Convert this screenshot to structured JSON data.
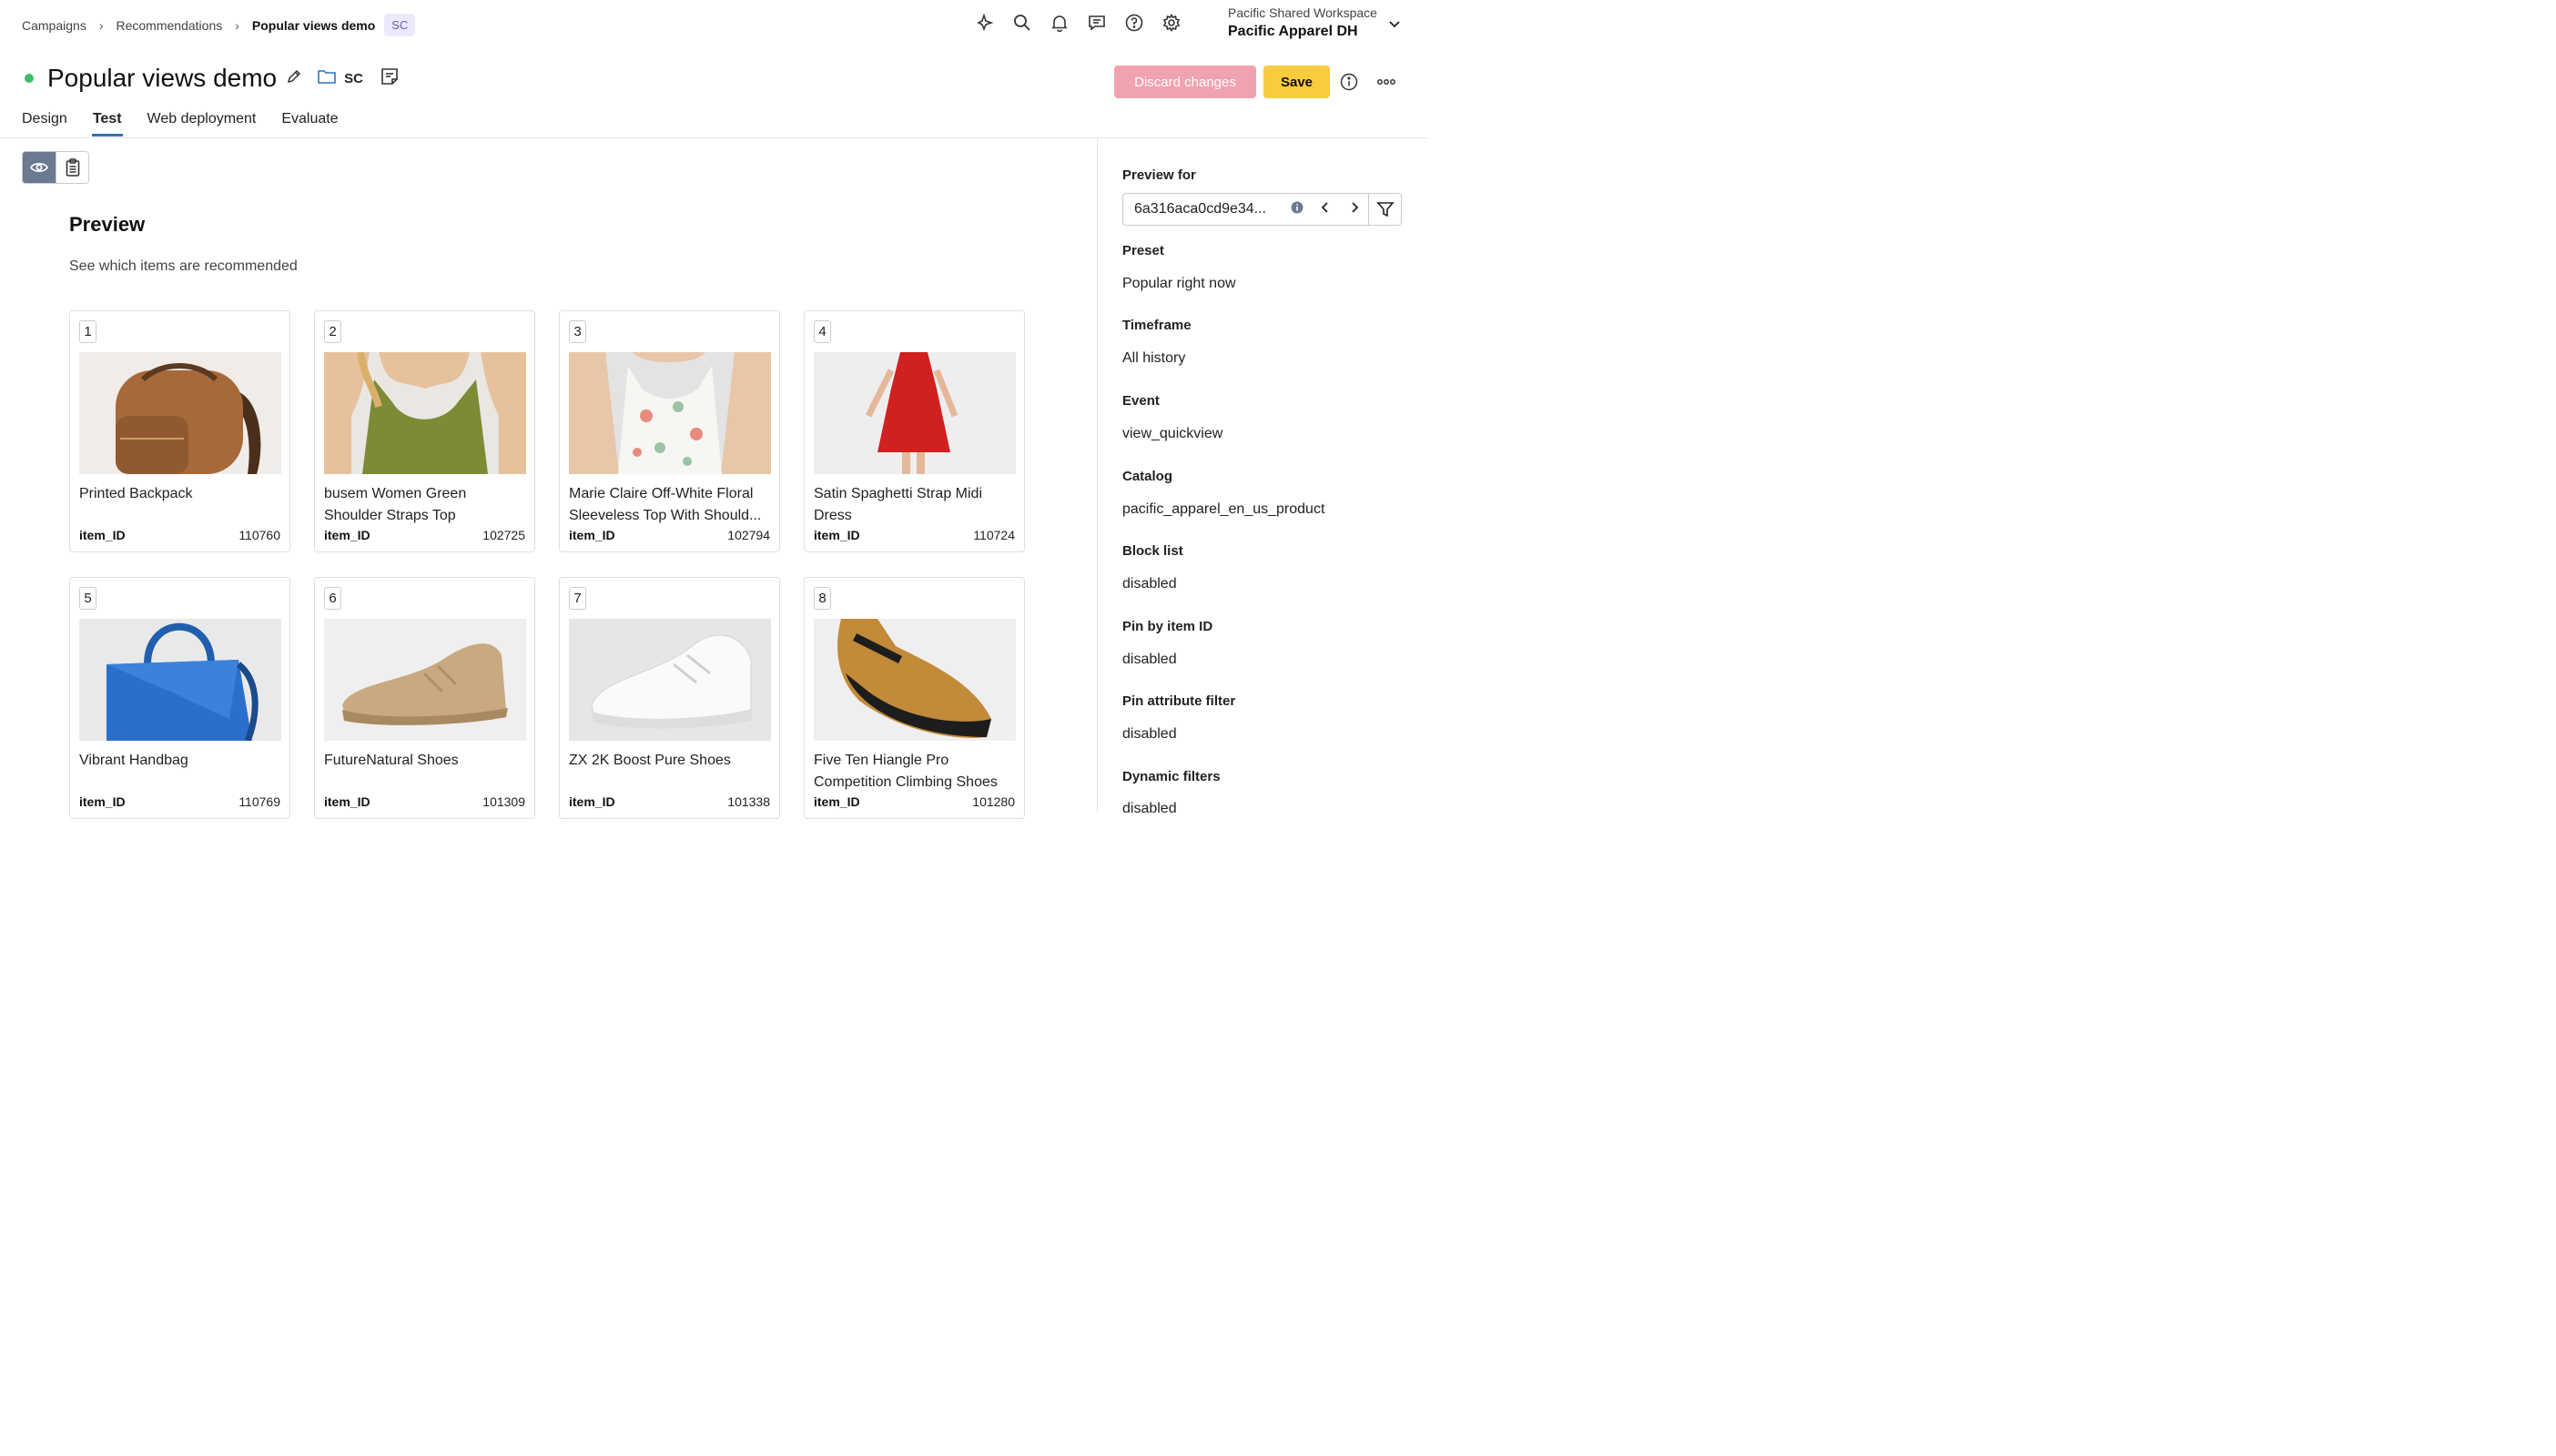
{
  "breadcrumb": {
    "items": [
      "Campaigns",
      "Recommendations"
    ],
    "current": "Popular views demo",
    "badge": "SC"
  },
  "header": {
    "icons": [
      "sparkle-icon",
      "search-icon",
      "bell-icon",
      "chat-icon",
      "help-icon",
      "gear-icon"
    ],
    "workspace_name": "Pacific Shared Workspace",
    "org_name": "Pacific Apparel DH"
  },
  "title": {
    "text": "Popular views demo",
    "folder_label": "SC",
    "status_color": "#3ebd6a"
  },
  "actions": {
    "discard_label": "Discard changes",
    "save_label": "Save"
  },
  "tabs": [
    {
      "label": "Design"
    },
    {
      "label": "Test",
      "active": true
    },
    {
      "label": "Web deployment"
    },
    {
      "label": "Evaluate"
    }
  ],
  "preview": {
    "title": "Preview",
    "subtitle": "See which items are recommended",
    "id_label": "item_ID",
    "items": [
      {
        "rank": "1",
        "name": "Printed Backpack",
        "id": "110760",
        "image": "backpack"
      },
      {
        "rank": "2",
        "name": "busem Women Green Shoulder Straps Top",
        "id": "102725",
        "image": "green-top"
      },
      {
        "rank": "3",
        "name": "Marie Claire Off-White Floral Sleeveless Top With Should...",
        "id": "102794",
        "image": "floral-top"
      },
      {
        "rank": "4",
        "name": "Satin Spaghetti Strap Midi Dress",
        "id": "110724",
        "image": "red-dress"
      },
      {
        "rank": "5",
        "name": "Vibrant Handbag",
        "id": "110769",
        "image": "blue-handbag"
      },
      {
        "rank": "6",
        "name": "FutureNatural Shoes",
        "id": "101309",
        "image": "tan-sneaker"
      },
      {
        "rank": "7",
        "name": "ZX 2K Boost Pure Shoes",
        "id": "101338",
        "image": "white-sneaker"
      },
      {
        "rank": "8",
        "name": "Five Ten Hiangle Pro Competition Climbing Shoes",
        "id": "101280",
        "image": "climbing-shoe"
      }
    ]
  },
  "panel": {
    "preview_for_label": "Preview for",
    "preview_for_value": "6a316aca0cd9e34...",
    "fields": [
      {
        "label": "Preset",
        "value": "Popular right now"
      },
      {
        "label": "Timeframe",
        "value": "All history"
      },
      {
        "label": "Event",
        "value": "view_quickview"
      },
      {
        "label": "Catalog",
        "value": "pacific_apparel_en_us_product"
      },
      {
        "label": "Block list",
        "value": "disabled"
      },
      {
        "label": "Pin by item ID",
        "value": "disabled"
      },
      {
        "label": "Pin attribute filter",
        "value": "disabled"
      },
      {
        "label": "Dynamic filters",
        "value": "disabled"
      }
    ]
  },
  "colors": {
    "accent_tab": "#2d74b8",
    "discard_bg": "#f0a3af",
    "save_bg": "#f7cc3e",
    "toggle_active": "#6b7a91"
  }
}
